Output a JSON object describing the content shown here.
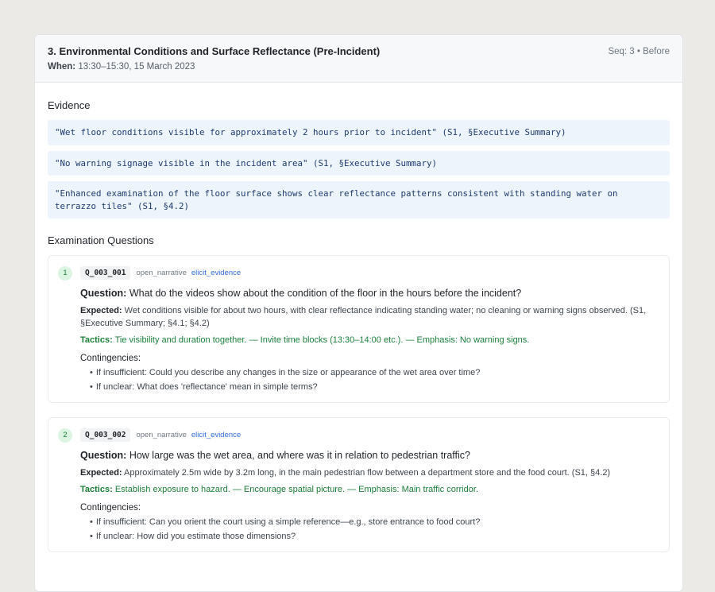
{
  "header": {
    "title": "3. Environmental Conditions and Surface Reflectance (Pre-Incident)",
    "when_label": "When:",
    "when_value": "13:30–15:30, 15 March 2023",
    "seq": "Seq: 3 • Before"
  },
  "evidence": {
    "title": "Evidence",
    "items": [
      "\"Wet floor conditions visible for approximately 2 hours prior to incident\" (S1, §Executive Summary)",
      "\"No warning signage visible in the incident area\" (S1, §Executive Summary)",
      "\"Enhanced examination of the floor surface shows clear reflectance patterns consistent with standing water on terrazzo tiles\" (S1, §4.2)"
    ]
  },
  "questions": {
    "title": "Examination Questions",
    "items": [
      {
        "num": "1",
        "id": "Q_003_001",
        "type": "open_narrative",
        "intent": "elicit_evidence",
        "question_label": "Question:",
        "question": "What do the videos show about the condition of the floor in the hours before the incident?",
        "expected_label": "Expected:",
        "expected": "Wet conditions visible for about two hours, with clear reflectance indicating standing water; no cleaning or warning signs observed. (S1, §Executive Summary; §4.1; §4.2)",
        "tactics_label": "Tactics:",
        "tactics": "Tie visibility and duration together. — Invite time blocks (13:30–14:00 etc.). — Emphasis: No warning signs.",
        "contingencies_label": "Contingencies:",
        "contingencies": [
          "If insufficient: Could you describe any changes in the size or appearance of the wet area over time?",
          "If unclear: What does 'reflectance' mean in simple terms?"
        ]
      },
      {
        "num": "2",
        "id": "Q_003_002",
        "type": "open_narrative",
        "intent": "elicit_evidence",
        "question_label": "Question:",
        "question": "How large was the wet area, and where was it in relation to pedestrian traffic?",
        "expected_label": "Expected:",
        "expected": "Approximately 2.5m wide by 3.2m long, in the main pedestrian flow between a department store and the food court. (S1, §4.2)",
        "tactics_label": "Tactics:",
        "tactics": "Establish exposure to hazard. — Encourage spatial picture. — Emphasis: Main traffic corridor.",
        "contingencies_label": "Contingencies:",
        "contingencies": [
          "If insufficient: Can you orient the court using a simple reference—e.g., store entrance to food court?",
          "If unclear: How did you estimate those dimensions?"
        ]
      }
    ]
  }
}
